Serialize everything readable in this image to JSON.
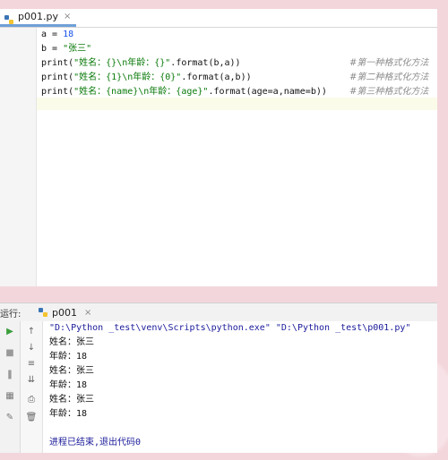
{
  "editor": {
    "tab": {
      "filename": "p001.py",
      "close": "×"
    },
    "lines": [
      {
        "pre": "a = ",
        "num": "18"
      },
      {
        "pre": "b = ",
        "str": "\"张三\""
      },
      {
        "a": "print(",
        "s": "\"姓名：{}\\n年龄：{}\"",
        "b": ".format(b,a))",
        "comment": "#第一种格式化方法"
      },
      {
        "a": "print(",
        "s": "\"姓名：{1}\\n年龄：{0}\"",
        "b": ".format(a,b))",
        "comment": "#第二种格式化方法"
      },
      {
        "a": "print(",
        "s": "\"姓名：{name}\\n年龄：{age}\"",
        "b": ".format(age=a,name=b))",
        "comment": "#第三种格式化方法"
      }
    ]
  },
  "run": {
    "title": "运行:",
    "tab_label": "p001",
    "tab_close": "×",
    "toolbar_icons": [
      "run-icon",
      "up-icon",
      "stop-icon",
      "down-icon",
      "pause-icon",
      "wrap-icon",
      "layout-icon",
      "sort-icon",
      "pin-icon",
      "print-icon",
      "trash-icon"
    ],
    "output": [
      "\"D:\\Python _test\\venv\\Scripts\\python.exe\" \"D:\\Python _test\\p001.py\"",
      "姓名：张三",
      "年龄：18",
      "姓名：张三",
      "年龄：18",
      "姓名：张三",
      "年龄：18",
      "",
      "进程已结束,退出代码0"
    ]
  },
  "colors": {
    "background": "#f3d6dc",
    "string": "#0a7a0a",
    "number": "#1750eb",
    "comment": "#8c8c8c",
    "console_cmd": "#1a1a9a"
  }
}
